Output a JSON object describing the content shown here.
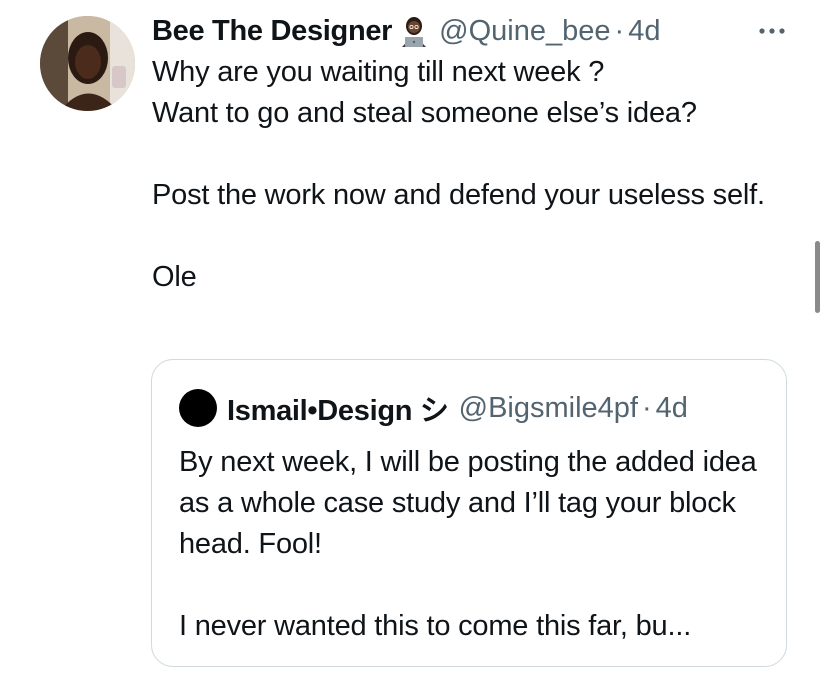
{
  "tweet": {
    "display_name": "Bee The Designer",
    "name_emoji_icon": "woman-technologist-icon",
    "handle": "@Quine_bee",
    "separator": "·",
    "time": "4d",
    "text": "Why are you waiting till next week ?\nWant to go and steal someone else’s idea?\n\nPost the work now and defend your useless self.\n\nOle"
  },
  "quoted_tweet": {
    "display_name": "Ismail•Design シ",
    "handle": "@Bigsmile4pf",
    "separator": "·",
    "time": "4d",
    "text": "By next week, I will be posting the added idea as a whole case study and I’ll tag your block head. Fool!\n\nI never wanted this to come this far, bu..."
  },
  "colors": {
    "text_primary": "#0f1419",
    "text_secondary": "#536471",
    "border": "#cfd9de"
  }
}
